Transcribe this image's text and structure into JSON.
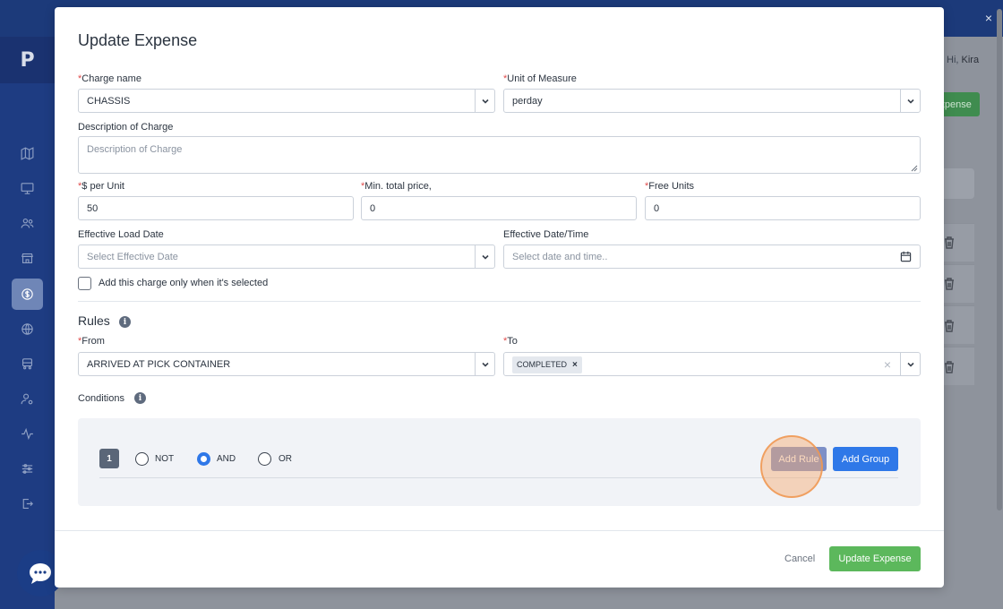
{
  "background": {
    "logo": "P",
    "greeting_prefix": "Hi,",
    "greeting_name": "Kira",
    "green_button_label": "Expense",
    "close_glyph": "×"
  },
  "modal": {
    "title": "Update Expense",
    "charge_name": {
      "label": "Charge name",
      "value": "CHASSIS"
    },
    "unit_of_measure": {
      "label": "Unit of Measure",
      "value": "perday"
    },
    "description": {
      "label": "Description of Charge",
      "placeholder": "Description of Charge"
    },
    "per_unit": {
      "label": "$ per Unit",
      "value": "50"
    },
    "min_total_price": {
      "label": "Min. total price,",
      "value": "0"
    },
    "free_units": {
      "label": "Free Units",
      "value": "0"
    },
    "effective_load_date": {
      "label": "Effective Load Date",
      "placeholder": "Select Effective Date"
    },
    "effective_datetime": {
      "label": "Effective Date/Time",
      "placeholder": "Select date and time.."
    },
    "checkbox_label": "Add this charge only when it's selected",
    "rules": {
      "title": "Rules",
      "from": {
        "label": "From",
        "value": "ARRIVED AT PICK CONTAINER"
      },
      "to": {
        "label": "To",
        "tag": "COMPLETED"
      }
    },
    "conditions": {
      "title": "Conditions",
      "group_number": "1",
      "options": [
        "NOT",
        "AND",
        "OR"
      ],
      "selected": "AND",
      "add_rule_label": "Add Rule",
      "add_group_label": "Add Group"
    },
    "footer": {
      "cancel_label": "Cancel",
      "update_label": "Update Expense"
    }
  },
  "colors": {
    "primary": "#2f78e8",
    "success": "#5cb85c",
    "required": "#e04b4b",
    "click_highlight": "#f6aa6e"
  }
}
